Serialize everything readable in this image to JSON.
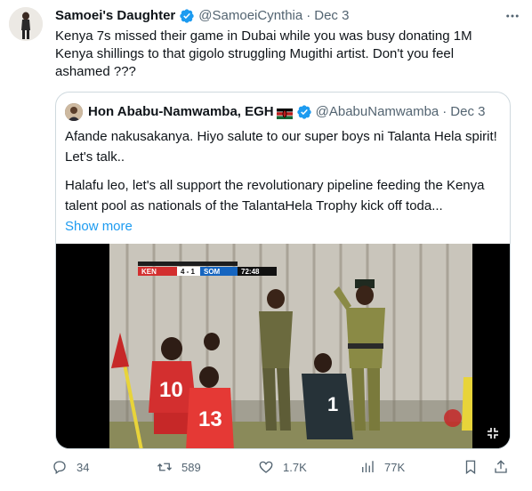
{
  "tweet": {
    "author_name": "Samoei's Daughter",
    "author_handle": "@SamoeiCynthia",
    "separator": "·",
    "date": "Dec 3",
    "text": "Kenya 7s missed their game in Dubai while you was busy donating 1M Kenya shillings to that gigolo struggling Mugithi artist. Don't you feel ashamed ???"
  },
  "quote": {
    "author_name": "Hon Ababu-Namwamba, EGH",
    "author_handle": "@AbabuNamwamba",
    "separator": "·",
    "date": "Dec 3",
    "paragraph1": "Afande nakusakanya. Hiyo salute to our super boys ni Talanta Hela spirit! Let's talk..",
    "paragraph2": "Halafu leo, let's all support the revolutionary pipeline feeding the Kenya talent pool as nationals of the TalantaHela Trophy kick off toda...",
    "show_more": "Show more",
    "scoreboard": {
      "team1": "KEN",
      "score": "4 - 1",
      "team2": "SOM",
      "time": "72:48"
    },
    "jersey_numbers": [
      "10",
      "13",
      "1"
    ]
  },
  "actions": {
    "reply_count": "34",
    "retweet_count": "589",
    "like_count": "1.7K",
    "view_count": "77K"
  },
  "colors": {
    "accent": "#1d9bf0",
    "text": "#0f1419",
    "muted": "#536471",
    "border": "#cfd9de"
  }
}
